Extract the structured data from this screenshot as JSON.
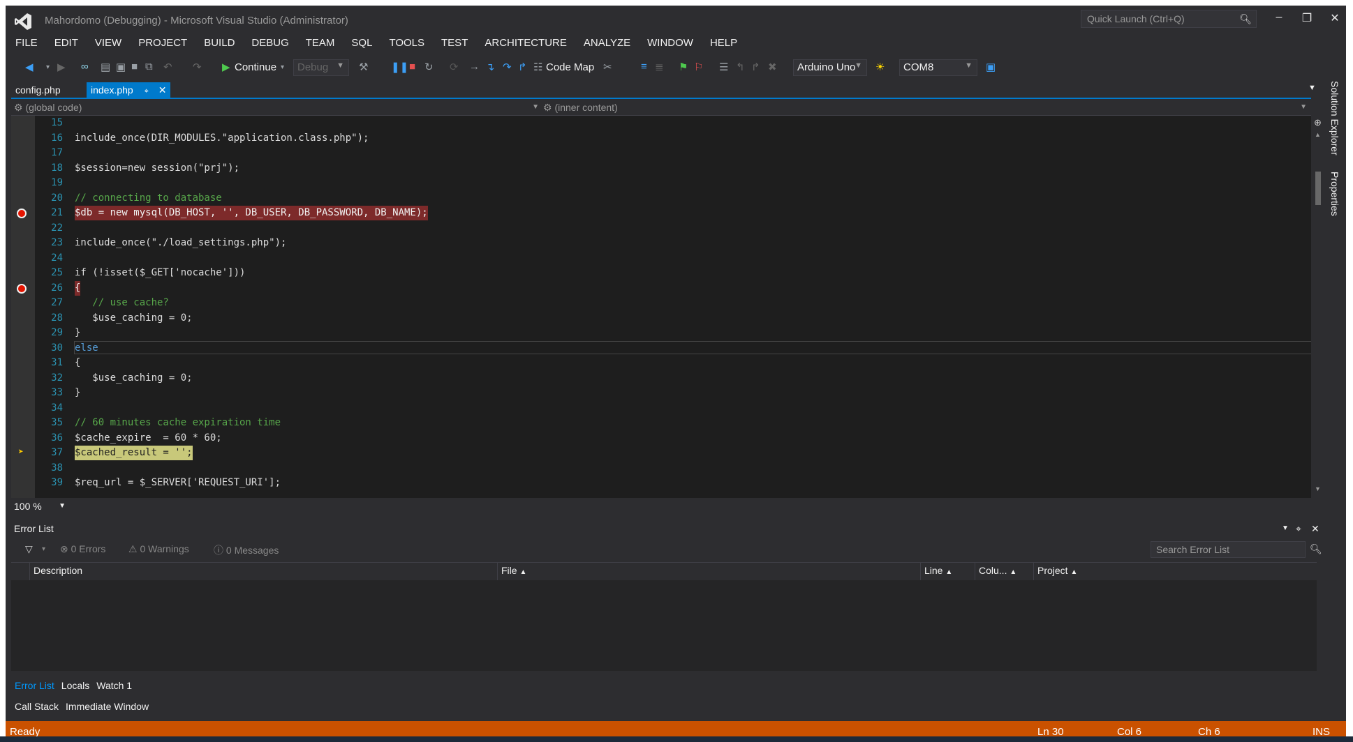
{
  "window": {
    "title": "Mahordomo (Debugging) - Microsoft Visual Studio (Administrator)",
    "quick_launch_placeholder": "Quick Launch (Ctrl+Q)"
  },
  "menu": [
    "FILE",
    "EDIT",
    "VIEW",
    "PROJECT",
    "BUILD",
    "DEBUG",
    "TEAM",
    "SQL",
    "TOOLS",
    "TEST",
    "ARCHITECTURE",
    "ANALYZE",
    "WINDOW",
    "HELP"
  ],
  "toolbar": {
    "continue_label": "Continue",
    "config_value": "Debug",
    "code_map_label": "Code Map",
    "board_value": "Arduino Uno",
    "port_value": "COM8"
  },
  "tabs": [
    {
      "label": "config.php",
      "active": false
    },
    {
      "label": "index.php",
      "active": true
    }
  ],
  "nav": {
    "left": "(global code)",
    "right": "(inner content)"
  },
  "editor": {
    "zoom": "100 %",
    "current_line": 30,
    "lines": [
      {
        "n": "15",
        "code": "",
        "style": ""
      },
      {
        "n": "16",
        "code": "include_once(DIR_MODULES.\"application.class.php\");",
        "style": ""
      },
      {
        "n": "17",
        "code": "",
        "style": ""
      },
      {
        "n": "18",
        "code": "$session=new session(\"prj\");",
        "style": ""
      },
      {
        "n": "19",
        "code": "",
        "style": ""
      },
      {
        "n": "20",
        "code": "// connecting to database",
        "style": "cmt"
      },
      {
        "n": "21",
        "code": "$db = new mysql(DB_HOST, '', DB_USER, DB_PASSWORD, DB_NAME);",
        "style": "bp"
      },
      {
        "n": "22",
        "code": "",
        "style": ""
      },
      {
        "n": "23",
        "code": "include_once(\"./load_settings.php\");",
        "style": ""
      },
      {
        "n": "24",
        "code": "",
        "style": ""
      },
      {
        "n": "25",
        "code": "if (!isset($_GET['nocache']))",
        "style": ""
      },
      {
        "n": "26",
        "code": "{",
        "style": "bp"
      },
      {
        "n": "27",
        "code": "   // use cache?",
        "style": "cmt"
      },
      {
        "n": "28",
        "code": "   $use_caching = 0;",
        "style": ""
      },
      {
        "n": "29",
        "code": "}",
        "style": ""
      },
      {
        "n": "30",
        "code": "else ",
        "style": "kw"
      },
      {
        "n": "31",
        "code": "{",
        "style": ""
      },
      {
        "n": "32",
        "code": "   $use_caching = 0;",
        "style": ""
      },
      {
        "n": "33",
        "code": "}",
        "style": ""
      },
      {
        "n": "34",
        "code": "",
        "style": ""
      },
      {
        "n": "35",
        "code": "// 60 minutes cache expiration time",
        "style": "cmt"
      },
      {
        "n": "36",
        "code": "$cache_expire  = 60 * 60;",
        "style": ""
      },
      {
        "n": "37",
        "code": "$cached_result = '';",
        "style": "cur"
      },
      {
        "n": "38",
        "code": "",
        "style": ""
      },
      {
        "n": "39",
        "code": "$req_url = $_SERVER['REQUEST_URI'];",
        "style": ""
      }
    ]
  },
  "side_tabs": {
    "solution_explorer": "Solution Explorer",
    "properties": "Properties"
  },
  "error_list": {
    "title": "Error List",
    "errors": "0 Errors",
    "warnings": "0 Warnings",
    "messages": "0 Messages",
    "search_placeholder": "Search Error List",
    "columns": {
      "description": "Description",
      "file": "File",
      "line": "Line",
      "column": "Colu...",
      "project": "Project"
    }
  },
  "bottom_tabs": [
    "Error List",
    "Locals",
    "Watch 1"
  ],
  "bottom_tabs2": [
    "Call Stack",
    "Immediate Window"
  ],
  "status": {
    "state": "Ready",
    "ln": "Ln 30",
    "col": "Col 6",
    "ch": "Ch 6",
    "mode": "INS"
  },
  "colors": {
    "accent": "#007acc",
    "status_bar": "#ca5100",
    "breakpoint": "#e51400"
  }
}
